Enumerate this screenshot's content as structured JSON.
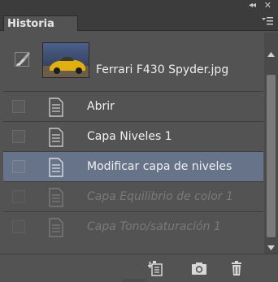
{
  "panel": {
    "tab_label": "Historia",
    "collapse_glyph": "◂◂",
    "close_glyph": "✕",
    "menu_icon": "panel-menu-icon"
  },
  "snapshot": {
    "name": "Ferrari F430 Spyder.jpg",
    "icon": "history-brush-icon"
  },
  "history": [
    {
      "label": "Abrir",
      "state": "normal"
    },
    {
      "label": "Capa Niveles 1",
      "state": "normal"
    },
    {
      "label": "Modificar capa de niveles",
      "state": "selected"
    },
    {
      "label": "Capa Equilibrio de color 1",
      "state": "dimmed"
    },
    {
      "label": "Capa Tono/saturación 1",
      "state": "dimmed"
    }
  ],
  "bottom_buttons": [
    "new-document-from-state-icon",
    "camera-icon",
    "trash-icon"
  ],
  "colors": {
    "panel_bg": "#535353",
    "header_bg": "#3c3c3c",
    "selected_row": "#677389",
    "dim_text": "#7a7a7a"
  }
}
